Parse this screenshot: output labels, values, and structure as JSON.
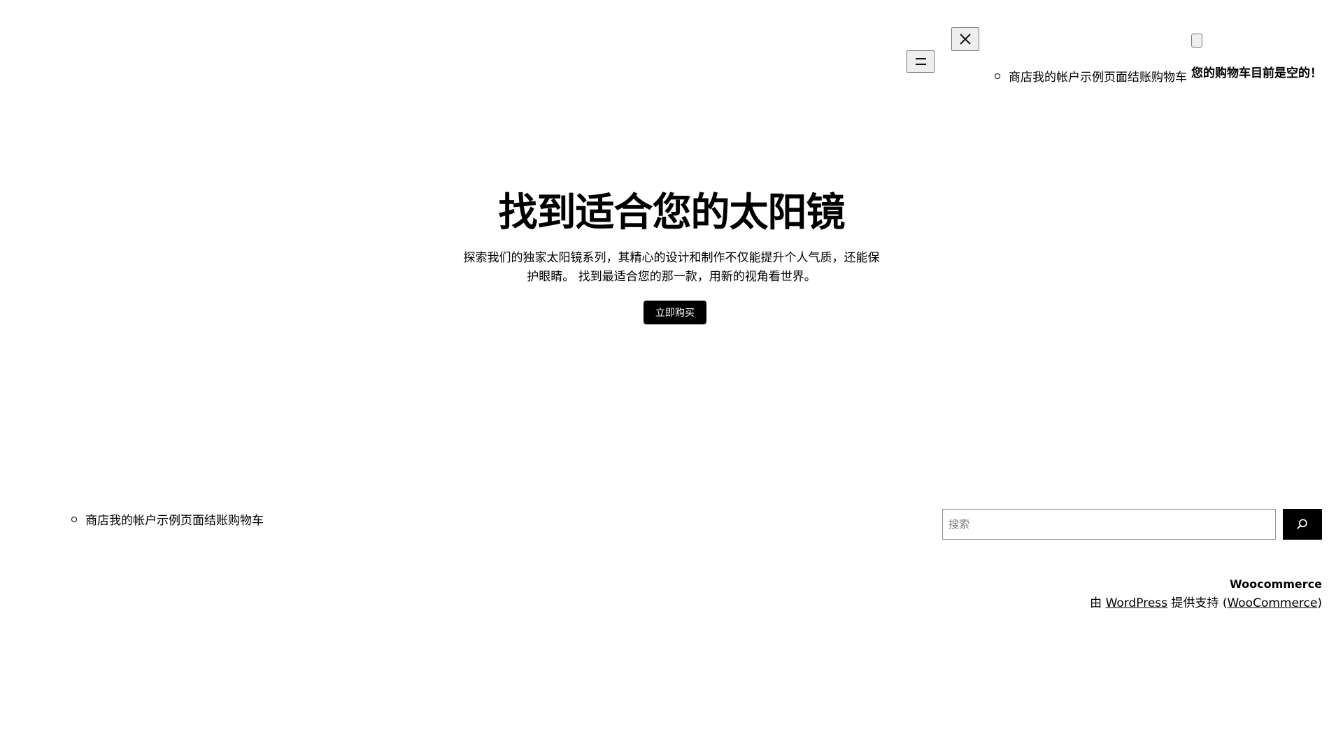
{
  "header": {
    "menu_icon": "hamburger-icon",
    "close_icon": "close-icon",
    "nav_items": [
      "商店",
      "我的帐户",
      "示例页面",
      "结账",
      "购物车"
    ],
    "cart_empty_text": "您的购物车目前是空的！"
  },
  "hero": {
    "title": "找到适合您的太阳镜",
    "description": "探索我们的独家太阳镜系列，其精心的设计和制作不仅能提升个人气质，还能保护眼睛。 找到最适合您的那一款，用新的视角看世界。",
    "cta_label": "立即购买"
  },
  "footer": {
    "nav_items": [
      "商店",
      "我的帐户",
      "示例页面",
      "结账",
      "购物车"
    ],
    "search": {
      "placeholder": "搜索",
      "button_icon": "search-icon"
    },
    "site_title": "Woocommerce",
    "credits": {
      "prefix": "由 ",
      "wordpress_link": "WordPress",
      "middle": " 提供支持 (",
      "woocommerce_link": "WooCommerce",
      "suffix": ")"
    }
  }
}
